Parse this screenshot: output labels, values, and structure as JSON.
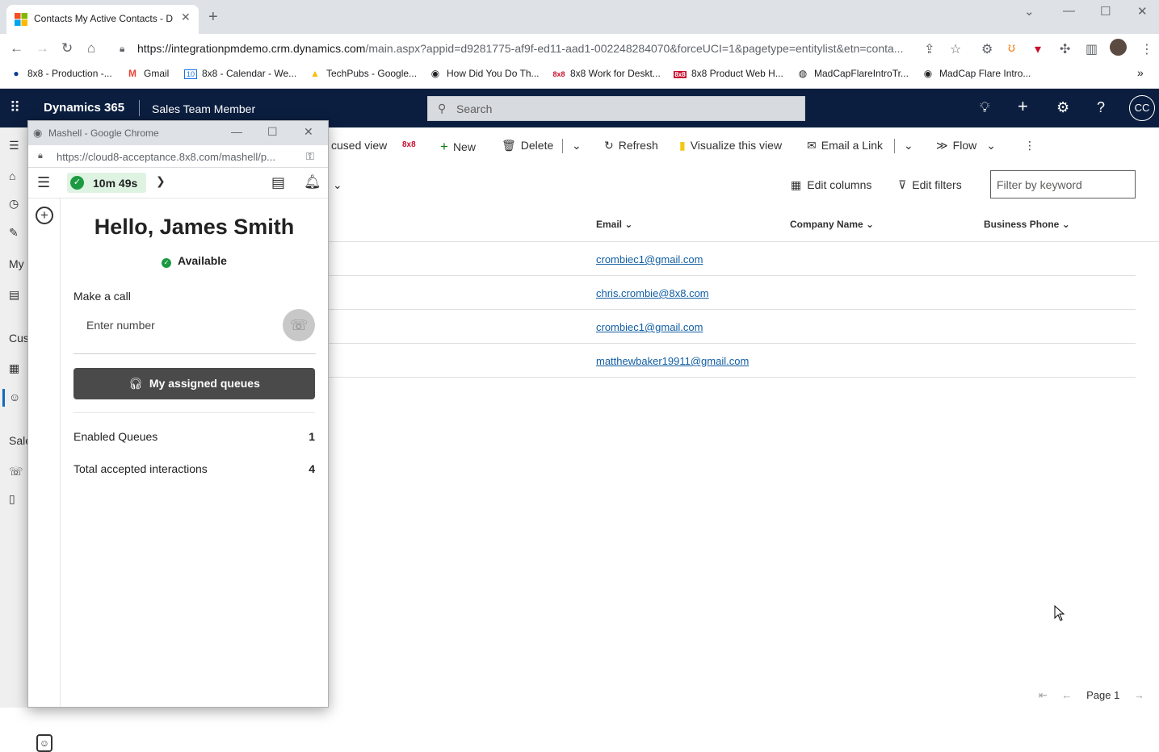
{
  "browser": {
    "tab_title": "Contacts My Active Contacts - D",
    "url_host": "https://integrationpmdemo.crm.dynamics.com",
    "url_rest": "/main.aspx?appid=d9281775-af9f-ed11-aad1-002248284070&forceUCI=1&pagetype=entitylist&etn=conta...",
    "bookmarks": [
      {
        "label": "8x8 - Production -...",
        "icon": "circle-icon"
      },
      {
        "label": "Gmail",
        "icon": "gmail-icon"
      },
      {
        "label": "8x8 - Calendar - We...",
        "icon": "calendar-icon"
      },
      {
        "label": "TechPubs - Google...",
        "icon": "drive-icon"
      },
      {
        "label": "How Did You Do Th...",
        "icon": "site-icon"
      },
      {
        "label": "8x8 Work for Deskt...",
        "icon": "8x8-icon"
      },
      {
        "label": "8x8 Product Web H...",
        "icon": "8x8-box-icon"
      },
      {
        "label": "MadCapFlareIntroTr...",
        "icon": "globe-icon"
      },
      {
        "label": "MadCap Flare Intro...",
        "icon": "site-icon"
      }
    ]
  },
  "d365": {
    "product": "Dynamics 365",
    "app": "Sales Team Member",
    "search_placeholder": "Search",
    "avatar": "CC"
  },
  "leftnav": {
    "my_label": "My",
    "customers_label": "Cus",
    "sales_label": "Sale"
  },
  "commandbar": {
    "focused_view": "cused view",
    "brand_8x8": "8x8",
    "new": "New",
    "delete": "Delete",
    "refresh": "Refresh",
    "visualize": "Visualize this view",
    "email_link": "Email a Link",
    "flow": "Flow"
  },
  "gridoptions": {
    "edit_columns": "Edit columns",
    "edit_filters": "Edit filters",
    "filter_placeholder": "Filter by keyword"
  },
  "grid": {
    "columns": [
      "Email",
      "Company Name",
      "Business Phone"
    ],
    "rows": [
      {
        "email": "crombiec1@gmail.com"
      },
      {
        "email": "chris.crombie@8x8.com"
      },
      {
        "email": "crombiec1@gmail.com"
      },
      {
        "email": "matthewbaker19911@gmail.com"
      }
    ],
    "page_label": "Page 1"
  },
  "popup": {
    "window_title": "Mashell - Google Chrome",
    "url": "https://cloud8-acceptance.8x8.com/mashell/p...",
    "timer": "10m 49s",
    "greeting": "Hello, James Smith",
    "status": "Available",
    "make_call_label": "Make a call",
    "number_placeholder": "Enter number",
    "queues_button": "My assigned queues",
    "stats": [
      {
        "label": "Enabled Queues",
        "value": "1"
      },
      {
        "label": "Total accepted interactions",
        "value": "4"
      }
    ]
  },
  "colors": {
    "d365_header": "#0b1e3f",
    "available_green": "#1c9a42",
    "link_blue": "#115ea3",
    "queues_button": "#4a4a4a"
  }
}
